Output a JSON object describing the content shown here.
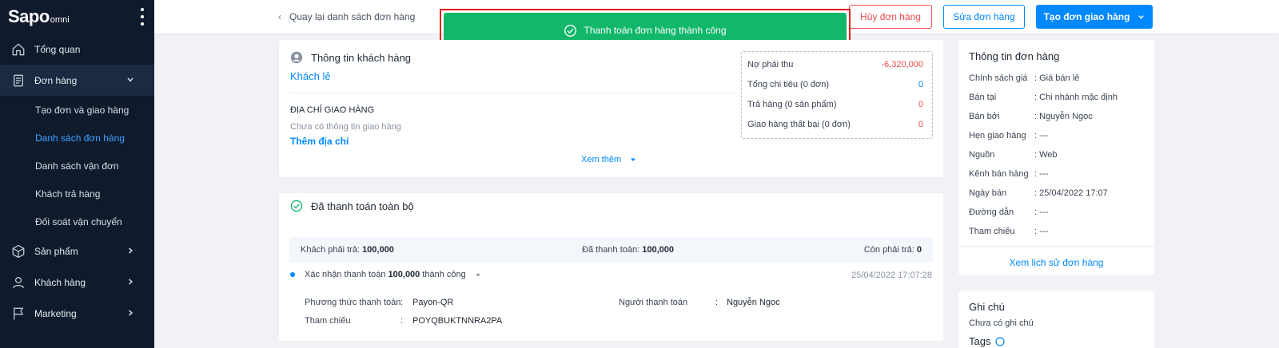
{
  "brand": {
    "logo_main": "Sapo",
    "logo_sub": "omni"
  },
  "sidebar": {
    "items": [
      {
        "label": "Tổng quan",
        "icon": "home-icon"
      },
      {
        "label": "Đơn hàng",
        "icon": "order-icon"
      },
      {
        "label": "Sản phẩm",
        "icon": "box-icon"
      },
      {
        "label": "Khách hàng",
        "icon": "user-icon"
      },
      {
        "label": "Marketing",
        "icon": "flag-icon"
      }
    ],
    "order_sub": [
      "Tạo đơn và giao hàng",
      "Danh sách đơn hàng",
      "Danh sách vận đơn",
      "Khách trả hàng",
      "Đối soát vận chuyển"
    ]
  },
  "header": {
    "back_label": "Quay lại danh sách đơn hàng",
    "cancel_label": "Hủy đơn hàng",
    "edit_label": "Sửa đơn hàng",
    "create_label": "Tạo đơn giao hàng"
  },
  "toast": {
    "message": "Thanh toán đơn hàng thành công",
    "color": "#12b76a"
  },
  "customer": {
    "title": "Thông tin khách hàng",
    "name": "Khách lẻ",
    "address_heading": "ĐỊA CHỈ GIAO HÀNG",
    "address_empty": "Chưa có thông tin giao hàng",
    "add_address": "Thêm địa chỉ",
    "see_more": "Xem thêm",
    "stats": [
      {
        "label": "Nợ phải thu",
        "value": "-6,320,000"
      },
      {
        "label": "Tổng chi tiêu (0 đơn)",
        "value": "0"
      },
      {
        "label": "Trả hàng (0 sản phẩm)",
        "value": "0"
      },
      {
        "label": "Giao hàng thất bại (0 đơn)",
        "value": "0"
      }
    ]
  },
  "payment": {
    "title": "Đã thanh toán toàn bộ",
    "customer_pay_label": "Khách phải trả:",
    "customer_pay_value": "100,000",
    "paid_label": "Đã thanh toán:",
    "paid_value": "100,000",
    "remaining_label": "Còn phải trả:",
    "remaining_value": "0",
    "confirm_prefix": "Xác nhận thanh toán",
    "confirm_amount": "100,000",
    "confirm_suffix": "thành công",
    "confirm_time": "25/04/2022 17:07:28",
    "method_label": "Phương thức thanh toán",
    "method_value": "Payon-QR",
    "payer_label": "Người thanh toán",
    "payer_value": "Nguyễn Ngọc",
    "ref_label": "Tham chiếu",
    "ref_value": "POYQBUKTNNRA2PA"
  },
  "order_info": {
    "title": "Thông tin đơn hàng",
    "rows": [
      {
        "k": "Chính sách giá",
        "v": ": Giá bán lẻ"
      },
      {
        "k": "Bán tại",
        "v": ": Chi nhánh mặc định"
      },
      {
        "k": "Bán bởi",
        "v": ": Nguyễn Ngọc"
      },
      {
        "k": "Hẹn giao hàng",
        "v": ": ---"
      },
      {
        "k": "Nguồn",
        "v": ": Web"
      },
      {
        "k": "Kênh bán hàng",
        "v": ": ---"
      },
      {
        "k": "Ngày bán",
        "v": ": 25/04/2022 17:07"
      },
      {
        "k": "Đường dẫn",
        "v": ": ---"
      },
      {
        "k": "Tham chiếu",
        "v": ": ---"
      }
    ],
    "history_link": "Xem lịch sử đơn hàng"
  },
  "note": {
    "title": "Ghi chú",
    "empty": "Chưa có ghi chú",
    "tags_label": "Tags"
  }
}
